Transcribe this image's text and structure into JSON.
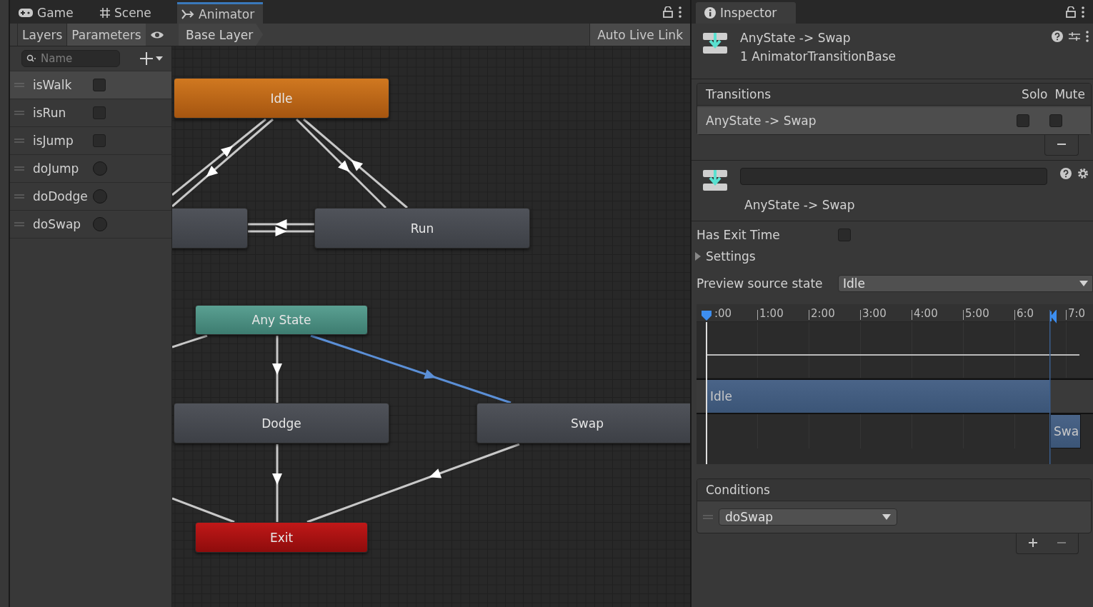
{
  "editor_tabs": [
    {
      "label": "Game",
      "selected": false
    },
    {
      "label": "Scene",
      "selected": false
    },
    {
      "label": "Animator",
      "selected": true
    }
  ],
  "animator": {
    "panel_tabs": [
      {
        "label": "Layers",
        "selected": false
      },
      {
        "label": "Parameters",
        "selected": true
      }
    ],
    "breadcrumb": "Base Layer",
    "auto_live_link": "Auto Live Link",
    "search": {
      "placeholder": "Name"
    },
    "parameters": [
      {
        "name": "isWalk",
        "kind": "bool",
        "checked": false,
        "selected": true
      },
      {
        "name": "isRun",
        "kind": "bool",
        "checked": false,
        "selected": false
      },
      {
        "name": "isJump",
        "kind": "bool",
        "checked": false,
        "selected": false
      },
      {
        "name": "doJump",
        "kind": "trigger",
        "checked": false,
        "selected": false
      },
      {
        "name": "doDodge",
        "kind": "trigger",
        "checked": false,
        "selected": false
      },
      {
        "name": "doSwap",
        "kind": "trigger",
        "checked": false,
        "selected": false
      }
    ],
    "states": [
      {
        "label": "Idle",
        "kind": "default"
      },
      {
        "kind": "normal"
      },
      {
        "label": "Run",
        "kind": "normal"
      },
      {
        "label": "Any State",
        "kind": "any"
      },
      {
        "label": "Dodge",
        "kind": "normal"
      },
      {
        "label": "Swap",
        "kind": "normal"
      },
      {
        "label": "Exit",
        "kind": "exit"
      }
    ]
  },
  "inspector": {
    "title": "Inspector",
    "header": {
      "title": "AnyState -> Swap",
      "subtitle": "1 AnimatorTransitionBase"
    },
    "transitions": {
      "title": "Transitions",
      "columns": [
        "Solo",
        "Mute"
      ],
      "rows": [
        {
          "name": "AnyState -> Swap",
          "solo": false,
          "mute": false,
          "selected": true
        }
      ]
    },
    "transition_label": "AnyState -> Swap",
    "has_exit_time": {
      "label": "Has Exit Time",
      "checked": false
    },
    "settings": {
      "label": "Settings",
      "expanded": false
    },
    "preview_source": {
      "label": "Preview source state",
      "value": "Idle"
    },
    "timeline": {
      "ticks": [
        ":00",
        "1:00",
        "2:00",
        "3:00",
        "4:00",
        "5:00",
        "6:0",
        "7:0"
      ],
      "tracks": [
        {
          "label": "Idle"
        },
        {
          "label": "Swa"
        }
      ]
    },
    "conditions": {
      "title": "Conditions",
      "items": [
        {
          "parameter": "doSwap"
        }
      ]
    }
  }
}
